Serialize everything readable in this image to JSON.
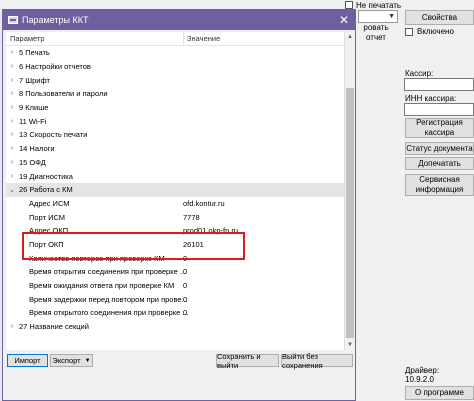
{
  "background": {
    "no_print_label": "Не печатать",
    "print_report_label": "ровать отчет",
    "properties_label": "Свойства",
    "enabled_label": "Включено",
    "cashier_label": "Кассир:",
    "cashier_inn_label": "ИНН кассира:",
    "register_cashier_label": "Регистрация кассира",
    "document_status_label": "Статус документа",
    "reprint_label": "Допечатать",
    "service_info_label": "Сервисная информация",
    "driver_label": "Драйвер:",
    "driver_version": "10.9.2.0",
    "about_label": "О программе"
  },
  "dialog": {
    "title": "Параметры ККТ",
    "columns": {
      "param": "Параметр",
      "value": "Значение"
    },
    "groups": [
      {
        "label": "5 Печать"
      },
      {
        "label": "6 Настройки отчетов"
      },
      {
        "label": "7 Шрифт"
      },
      {
        "label": "8 Пользователи и пароли"
      },
      {
        "label": "9 Клише"
      },
      {
        "label": "11 Wi-Fi"
      },
      {
        "label": "13 Скорость печати"
      },
      {
        "label": "14 Налоги"
      },
      {
        "label": "15 ОФД"
      },
      {
        "label": "19 Диагностика"
      },
      {
        "label": "26 Работа с КМ"
      }
    ],
    "km_params": [
      {
        "name": "Адрес ИСМ",
        "value": "ofd.kontur.ru"
      },
      {
        "name": "Порт ИСМ",
        "value": "7778"
      },
      {
        "name": "Адрес ОКП",
        "value": "prod01.okp-fn.ru"
      },
      {
        "name": "Порт ОКП",
        "value": "26101"
      },
      {
        "name": "Количество повторов при проверке КМ",
        "value": "0"
      },
      {
        "name": "Время открытия соединения при проверке ...",
        "value": "0"
      },
      {
        "name": "Время ожидания ответа при проверке КМ",
        "value": "0"
      },
      {
        "name": "Время задержки перед повтором при прове...",
        "value": "0"
      },
      {
        "name": "Время открытого соединения при проверке ...",
        "value": "0"
      }
    ],
    "last_group": {
      "label": "27 Название секций"
    },
    "buttons": {
      "import": "Импорт",
      "export": "Экспорт",
      "save_exit": "Сохранить и выйти",
      "exit_no_save": "Выйти без сохранения"
    }
  }
}
